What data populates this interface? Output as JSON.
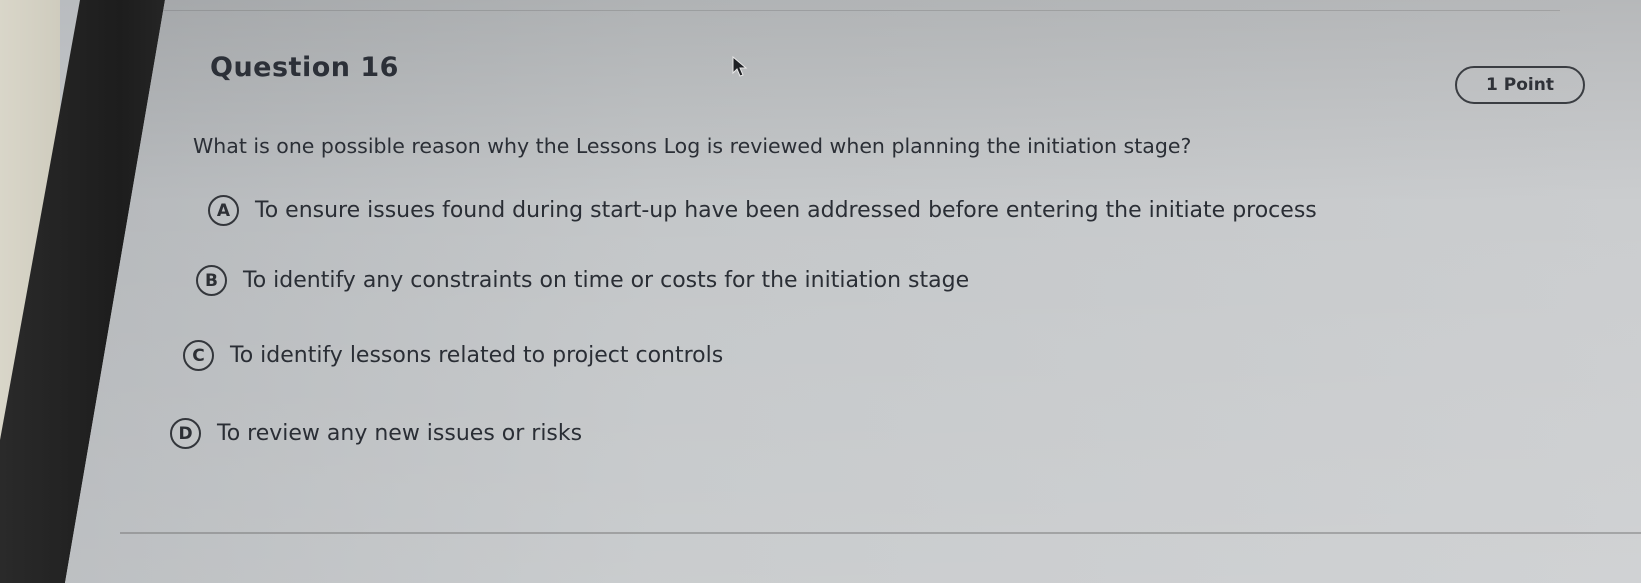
{
  "question": {
    "title": "Question 16",
    "points": "1 Point",
    "prompt": "What is one possible reason why the Lessons Log is reviewed when planning the initiation stage?"
  },
  "options": [
    {
      "letter": "A",
      "text": "To ensure issues found during start-up have been addressed before entering the initiate process"
    },
    {
      "letter": "B",
      "text": "To identify any constraints on time or costs for the initiation stage"
    },
    {
      "letter": "C",
      "text": "To identify lessons related to project controls"
    },
    {
      "letter": "D",
      "text": "To review any new issues or risks"
    }
  ],
  "icons": {
    "cursor": "mouse-pointer-icon"
  },
  "colors": {
    "text": "#2b2f36",
    "border": "#33363b",
    "screen": "#c4c7c9",
    "bezel": "#1d1d1d"
  }
}
